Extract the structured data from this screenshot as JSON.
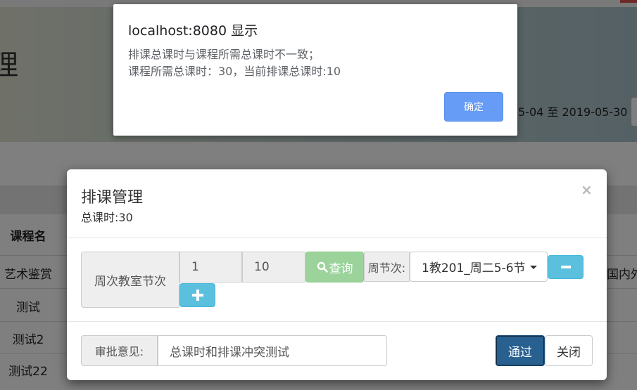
{
  "background": {
    "title_fragment": "理",
    "date_range": "5-04 至 2019-05-30",
    "table_header": "课程名",
    "rows": [
      "艺术鉴赏",
      "测试",
      "测试2",
      "测试22"
    ],
    "right_cell": "国内外"
  },
  "modal": {
    "title": "排课管理",
    "subtitle": "总课时:30",
    "close_symbol": "×",
    "week_label": "周次教室节次",
    "week_start": "1",
    "week_end": "10",
    "search_label": "查询",
    "section_label": "周节次:",
    "section_value": "1教201_周二5-6节",
    "opinion_label": "审批意见:",
    "opinion_value": "总课时和排课冲突测试",
    "pass_label": "通过",
    "close_label": "关闭"
  },
  "alert": {
    "title": "localhost:8080 显示",
    "line1": "排课总课时与课程所需总课时不一致；",
    "line2": "课程所需总课时：30，当前排课总课时:10",
    "ok_label": "确定"
  },
  "colors": {
    "primary": "#286090",
    "info": "#5bc0de",
    "success_disabled": "#9bd39b",
    "alert_button": "#679cf6"
  }
}
